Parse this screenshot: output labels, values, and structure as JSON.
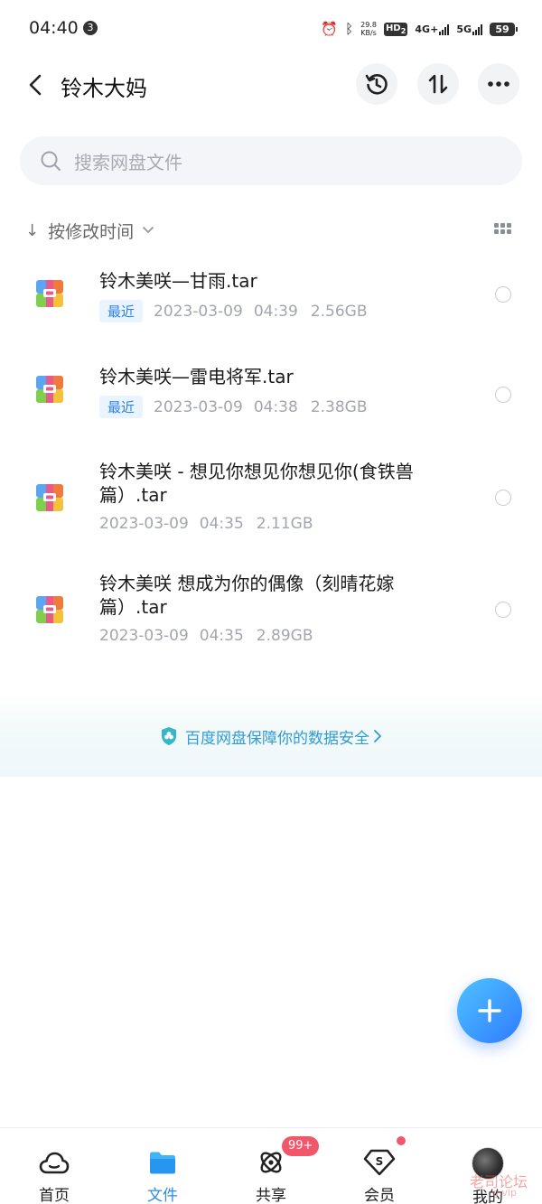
{
  "status_bar": {
    "time": "04:40",
    "notification_count": "3",
    "net_speed_value": "29.8",
    "net_speed_unit": "KB/s",
    "hd_label": "HD",
    "hd_sub": "2",
    "network_4g": "4G+",
    "network_5g": "5G",
    "battery": "59"
  },
  "header": {
    "title": "铃木大妈"
  },
  "search": {
    "placeholder": "搜索网盘文件"
  },
  "sort": {
    "label": "按修改时间"
  },
  "files": [
    {
      "name_line1": "铃木美咲—甘雨.tar",
      "name_line2": "",
      "badge": "最近",
      "date": "2023-03-09",
      "time": "04:39",
      "size": "2.56GB"
    },
    {
      "name_line1": "铃木美咲—雷电将军.tar",
      "name_line2": "",
      "badge": "最近",
      "date": "2023-03-09",
      "time": "04:38",
      "size": "2.38GB"
    },
    {
      "name_line1": "铃木美咲 - 想见你想见你想见你(食铁兽",
      "name_line2": "篇）.tar",
      "badge": "",
      "date": "2023-03-09",
      "time": "04:35",
      "size": "2.11GB"
    },
    {
      "name_line1": "铃木美咲 想成为你的偶像（刻晴花嫁",
      "name_line2": "篇）.tar",
      "badge": "",
      "date": "2023-03-09",
      "time": "04:35",
      "size": "2.89GB"
    }
  ],
  "security_banner": {
    "text": "百度网盘保障你的数据安全"
  },
  "bottom_nav": {
    "items": [
      {
        "label": "首页",
        "icon": "cloud-icon"
      },
      {
        "label": "文件",
        "icon": "folder-icon"
      },
      {
        "label": "共享",
        "icon": "share-orbit-icon"
      },
      {
        "label": "会员",
        "icon": "vip-dollar-icon"
      },
      {
        "label": "我的",
        "icon": "avatar"
      }
    ],
    "share_badge": "99+"
  },
  "watermark": {
    "text": "老司论坛",
    "sub": "g.vip"
  },
  "colors": {
    "accent": "#2b8bf0",
    "badge_bg": "#eaf4ff",
    "badge_text": "#2d84e0",
    "notification_red": "#f2566b",
    "security_text": "#2f9bd6"
  }
}
